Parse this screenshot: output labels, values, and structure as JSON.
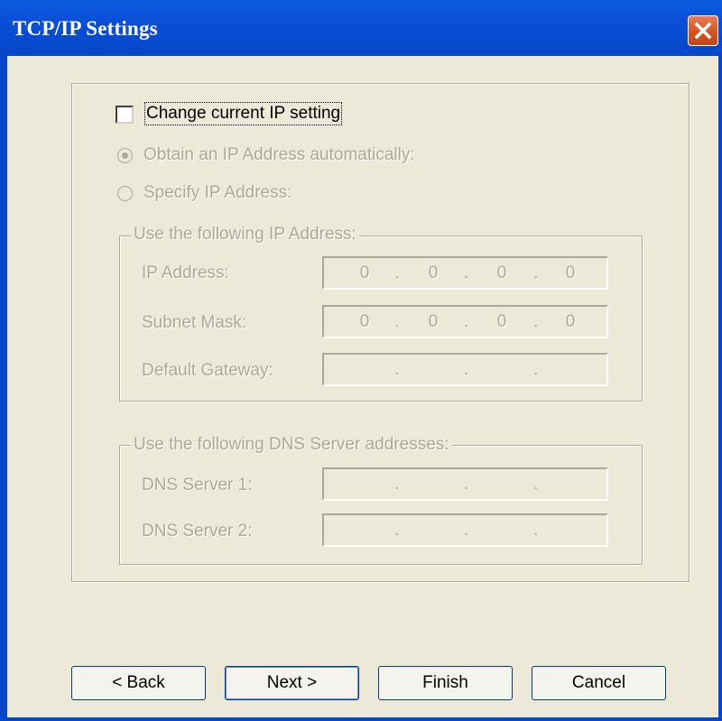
{
  "window": {
    "title": "TCP/IP Settings"
  },
  "colors": {
    "titlebar": "#0a4fd6",
    "close_button": "#d6531f",
    "dialog_bg": "#ece9d8",
    "disabled_text": "#aca899"
  },
  "icons": {
    "close": "close-icon"
  },
  "change_ip": {
    "label": "Change current IP setting",
    "checked": false
  },
  "ip_mode": {
    "auto_label": "Obtain an IP Address automatically:",
    "manual_label": "Specify IP Address:",
    "selected": "auto",
    "enabled": false
  },
  "ip_group": {
    "legend": "Use the following IP Address:",
    "fields": [
      {
        "label": "IP Address:",
        "octets": [
          "0",
          "0",
          "0",
          "0"
        ]
      },
      {
        "label": "Subnet Mask:",
        "octets": [
          "0",
          "0",
          "0",
          "0"
        ]
      },
      {
        "label": "Default Gateway:",
        "octets": [
          "",
          "",
          "",
          ""
        ]
      }
    ]
  },
  "dns_group": {
    "legend": "Use the following DNS Server addresses:",
    "fields": [
      {
        "label": "DNS Server 1:",
        "octets": [
          "",
          "",
          "",
          ""
        ]
      },
      {
        "label": "DNS Server 2:",
        "octets": [
          "",
          "",
          "",
          ""
        ]
      }
    ]
  },
  "buttons": {
    "back": "< Back",
    "next": "Next >",
    "finish": "Finish",
    "cancel": "Cancel"
  }
}
